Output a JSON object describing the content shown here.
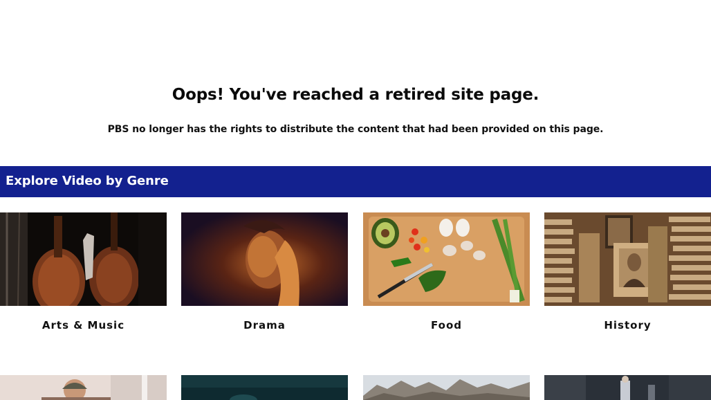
{
  "notice": {
    "title": "Oops! You've reached a retired site page.",
    "message": "PBS no longer has the rights to distribute the content that had been provided on this page."
  },
  "genre_section": {
    "title": "Explore Video by Genre",
    "accent_color": "#13218f",
    "genres": [
      {
        "label": "Arts & Music",
        "image": "cellos-photo"
      },
      {
        "label": "Drama",
        "image": "woman-portrait-photo"
      },
      {
        "label": "Food",
        "image": "cutting-board-vegetables-photo"
      },
      {
        "label": "History",
        "image": "vintage-photographs-photo"
      }
    ],
    "next_row_images": [
      "person-with-cap-photo",
      "dark-teal-photo",
      "mountain-range-photo",
      "city-street-photo"
    ]
  }
}
